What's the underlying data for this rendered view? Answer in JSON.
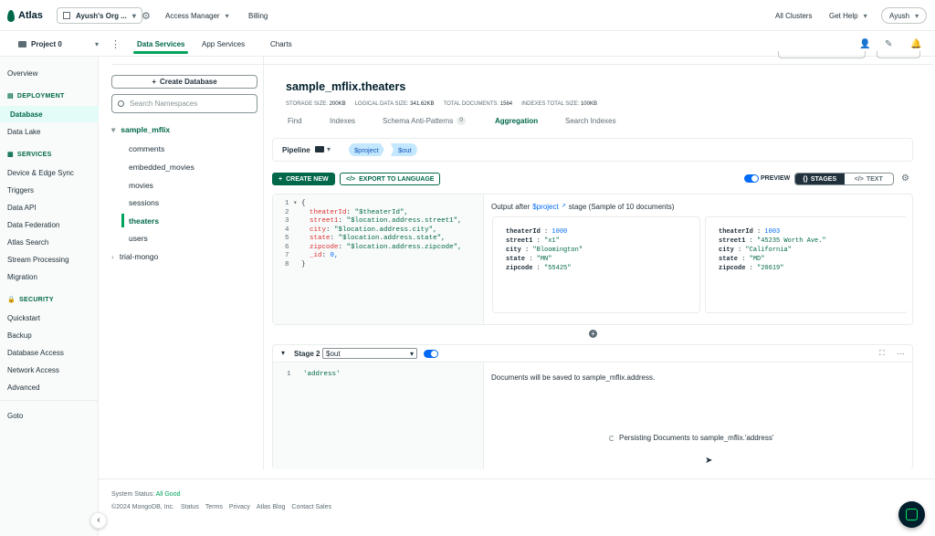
{
  "topbar": {
    "brand": "Atlas",
    "org": "Ayush's Org ...",
    "access_manager": "Access Manager",
    "billing": "Billing",
    "all_clusters": "All Clusters",
    "get_help": "Get Help",
    "user": "Ayush"
  },
  "projbar": {
    "project": "Project 0",
    "tabs": [
      "Data Services",
      "App Services",
      "Charts"
    ]
  },
  "leftnav": {
    "overview": "Overview",
    "deployment_head": "DEPLOYMENT",
    "database": "Database",
    "data_lake": "Data Lake",
    "services_head": "SERVICES",
    "services": [
      "Device & Edge Sync",
      "Triggers",
      "Data API",
      "Data Federation",
      "Atlas Search",
      "Stream Processing",
      "Migration"
    ],
    "security_head": "SECURITY",
    "security": [
      "Quickstart",
      "Backup",
      "Database Access",
      "Network Access",
      "Advanced"
    ],
    "goto": "Goto"
  },
  "namespaces": {
    "create_db": "Create Database",
    "search_placeholder": "Search Namespaces",
    "db1": "sample_mflix",
    "collections": [
      "comments",
      "embedded_movies",
      "movies",
      "sessions",
      "theaters",
      "users"
    ],
    "db2": "trial-mongo"
  },
  "collection": {
    "title": "sample_mflix.theaters",
    "stats": [
      {
        "label": "STORAGE SIZE:",
        "value": "200KB"
      },
      {
        "label": "LOGICAL DATA SIZE:",
        "value": "341.62KB"
      },
      {
        "label": "TOTAL DOCUMENTS:",
        "value": "1564"
      },
      {
        "label": "INDEXES TOTAL SIZE:",
        "value": "100KB"
      }
    ],
    "tabs": [
      "Find",
      "Indexes",
      "Schema Anti-Patterns",
      "Aggregation",
      "Search Indexes"
    ],
    "anti_patterns_count": "0"
  },
  "pipeline": {
    "label": "Pipeline",
    "stages": [
      "$project",
      "$out"
    ],
    "create_new": "CREATE NEW",
    "export": "EXPORT TO LANGUAGE",
    "preview": "PREVIEW",
    "stages_toggle": "STAGES",
    "text_toggle": "TEXT"
  },
  "stage1": {
    "code_lines": [
      {
        "n": "1",
        "t": "{"
      },
      {
        "n": "2",
        "k": "theaterId",
        "v": "\"$theaterId\","
      },
      {
        "n": "3",
        "k": "street1",
        "v": "\"$location.address.street1\","
      },
      {
        "n": "4",
        "k": "city",
        "v": "\"$location.address.city\","
      },
      {
        "n": "5",
        "k": "state",
        "v": "\"$location.address.state\","
      },
      {
        "n": "6",
        "k": "zipcode",
        "v": "\"$location.address.zipcode\","
      },
      {
        "n": "7",
        "k": "_id",
        "v": "0,"
      },
      {
        "n": "8",
        "t": "}"
      }
    ],
    "output_prefix": "Output after",
    "output_stage": "$project",
    "output_suffix": "stage (Sample of 10 documents)",
    "docs": [
      [
        {
          "k": "theaterId",
          "v": "1000",
          "num": true
        },
        {
          "k": "street1",
          "v": "\"x1\""
        },
        {
          "k": "city",
          "v": "\"Bloomington\""
        },
        {
          "k": "state",
          "v": "\"MN\""
        },
        {
          "k": "zipcode",
          "v": "\"55425\""
        }
      ],
      [
        {
          "k": "theaterId",
          "v": "1003",
          "num": true
        },
        {
          "k": "street1",
          "v": "\"45235 Worth Ave.\""
        },
        {
          "k": "city",
          "v": "\"California\""
        },
        {
          "k": "state",
          "v": "\"MD\""
        },
        {
          "k": "zipcode",
          "v": "\"20619\""
        }
      ]
    ]
  },
  "stage2": {
    "label": "Stage 2",
    "operator": "$out",
    "code_line_no": "1",
    "code": "'address'",
    "saved_msg": "Documents will be saved to sample_mflix.address.",
    "persisting_msg": "Persisting Documents to sample_mflix.'address'"
  },
  "footer": {
    "status_label": "System Status:",
    "status_value": "All Good",
    "copyright": "©2024 MongoDB, Inc.",
    "links": [
      "Status",
      "Terms",
      "Privacy",
      "Atlas Blog",
      "Contact Sales"
    ]
  },
  "colors": {
    "accent": "#00684a",
    "green": "#00a35c",
    "blue_pill": "#c3e7fe"
  }
}
